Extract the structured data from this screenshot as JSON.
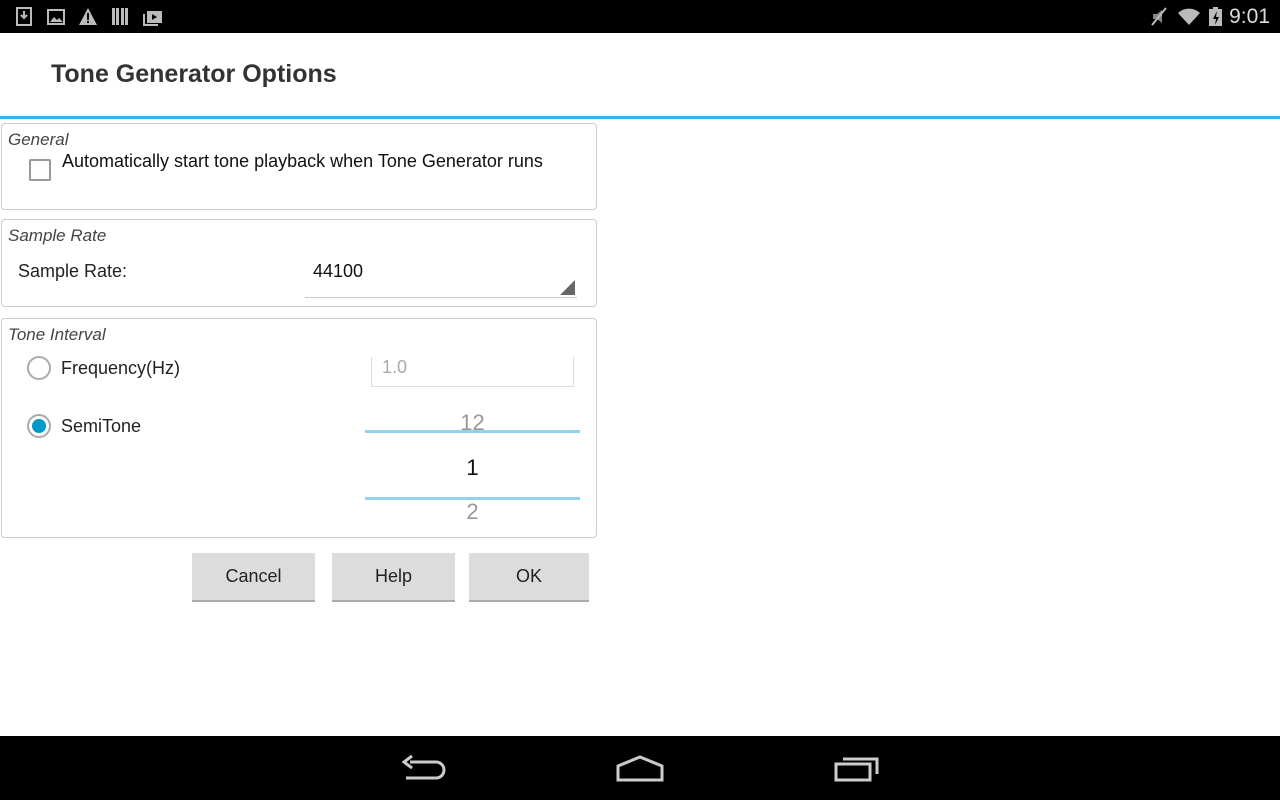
{
  "status_bar": {
    "time": "9:01",
    "left_icons": [
      "download-icon",
      "image-icon",
      "warning-icon",
      "barcode-icon",
      "play-store-icon"
    ],
    "right_icons": [
      "mute-icon",
      "wifi-icon",
      "battery-charging-icon"
    ]
  },
  "header": {
    "title": "Tone Generator Options"
  },
  "general": {
    "label": "General",
    "checkbox_label": "Automatically start tone playback when Tone Generator runs",
    "checked": false
  },
  "sample_rate": {
    "label": "Sample Rate",
    "field_label": "Sample Rate:",
    "value": "44100"
  },
  "tone_interval": {
    "label": "Tone Interval",
    "frequency_label": "Frequency(Hz)",
    "frequency_value": "1.0",
    "semitone_label": "SemiTone",
    "selected": "SemiTone",
    "picker_prev": "12",
    "picker_value": "1",
    "picker_next": "2"
  },
  "buttons": {
    "cancel": "Cancel",
    "help": "Help",
    "ok": "OK"
  },
  "accent": "#33b5e5"
}
